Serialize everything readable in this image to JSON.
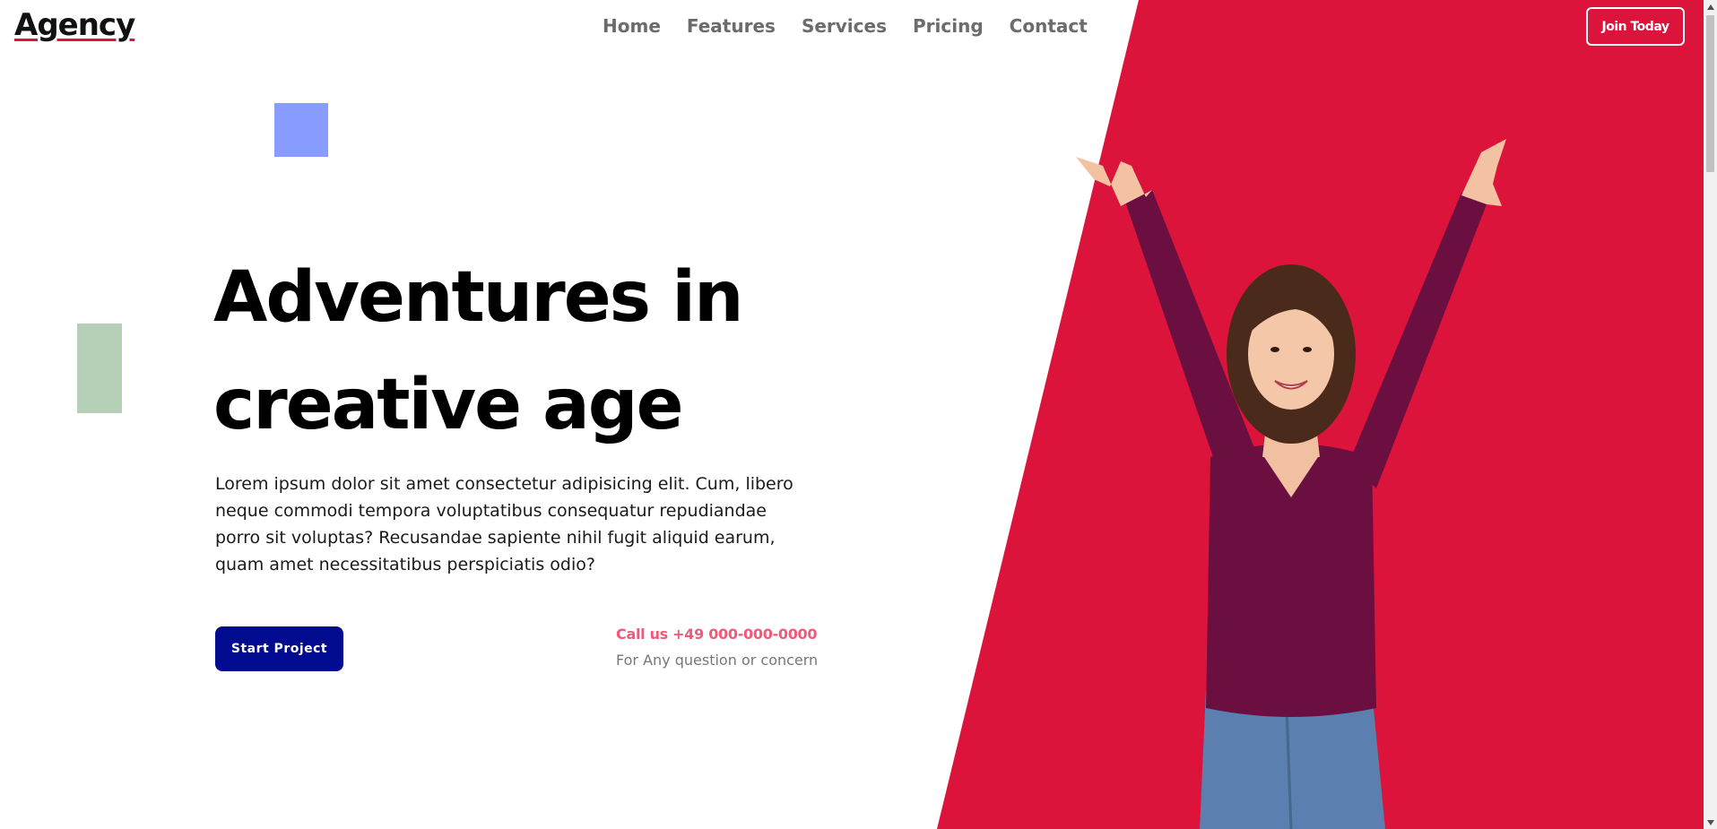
{
  "brand": {
    "logo_text": "Agency"
  },
  "nav": {
    "items": [
      {
        "label": "Home"
      },
      {
        "label": "Features"
      },
      {
        "label": "Services"
      },
      {
        "label": "Pricing"
      },
      {
        "label": "Contact"
      }
    ],
    "cta_label": "Join Today"
  },
  "hero": {
    "title_line1": "Adventures in",
    "title_line2": "creative age",
    "description": "Lorem ipsum dolor sit amet consectetur adipisicing elit. Cum, libero neque commodi tempora voluptatibus consequatur repudiandae porro sit voluptas? Recusandae sapiente nihil fugit aliquid earum, quam amet necessitatibus perspiciatis odio?",
    "primary_button_label": "Start Project",
    "call_text": "Call us +49 000-000-0000",
    "call_subtext": "For Any question or concern"
  },
  "colors": {
    "accent": "#dc143c",
    "primary_button": "#000b8f",
    "call_text": "#f05a78",
    "deco_blue": "#889cff",
    "deco_green": "#b5d0b7"
  },
  "icons": {
    "scroll_up": "triangle-up-icon",
    "scroll_down": "triangle-down-icon"
  }
}
